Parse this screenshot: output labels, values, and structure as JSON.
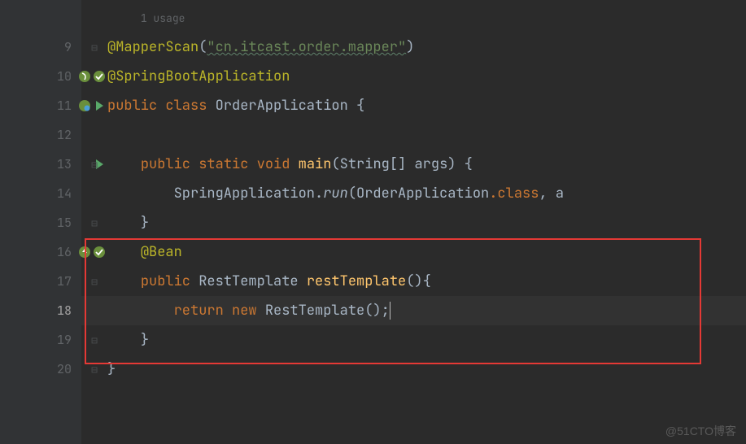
{
  "lines": [
    {
      "num": "",
      "hint": "1 usage"
    },
    {
      "num": "9"
    },
    {
      "num": "10"
    },
    {
      "num": "11"
    },
    {
      "num": "12"
    },
    {
      "num": "13"
    },
    {
      "num": "14"
    },
    {
      "num": "15"
    },
    {
      "num": "16"
    },
    {
      "num": "17"
    },
    {
      "num": "18"
    },
    {
      "num": "19"
    },
    {
      "num": "20"
    }
  ],
  "code": {
    "ann_mapper_scan": "@MapperScan",
    "mapper_scan_arg": "\"cn.itcast.order.mapper\"",
    "ann_spring_boot": "@SpringBootApplication",
    "kw_public": "public",
    "kw_class": "class",
    "class_name": "OrderApplication",
    "kw_static": "static",
    "kw_void": "void",
    "main": "main",
    "string_arr": "String[]",
    "args": "args",
    "spring_app": "SpringApplication",
    "run": "run",
    "order_app_class": "OrderApplication",
    "dot_class": ".class",
    "comma_a": ", a",
    "ann_bean": "@Bean",
    "rest_template_type": "RestTemplate",
    "rest_template_method": "restTemplate",
    "kw_return": "return",
    "kw_new": "new"
  },
  "watermark": "@51CTO博客"
}
